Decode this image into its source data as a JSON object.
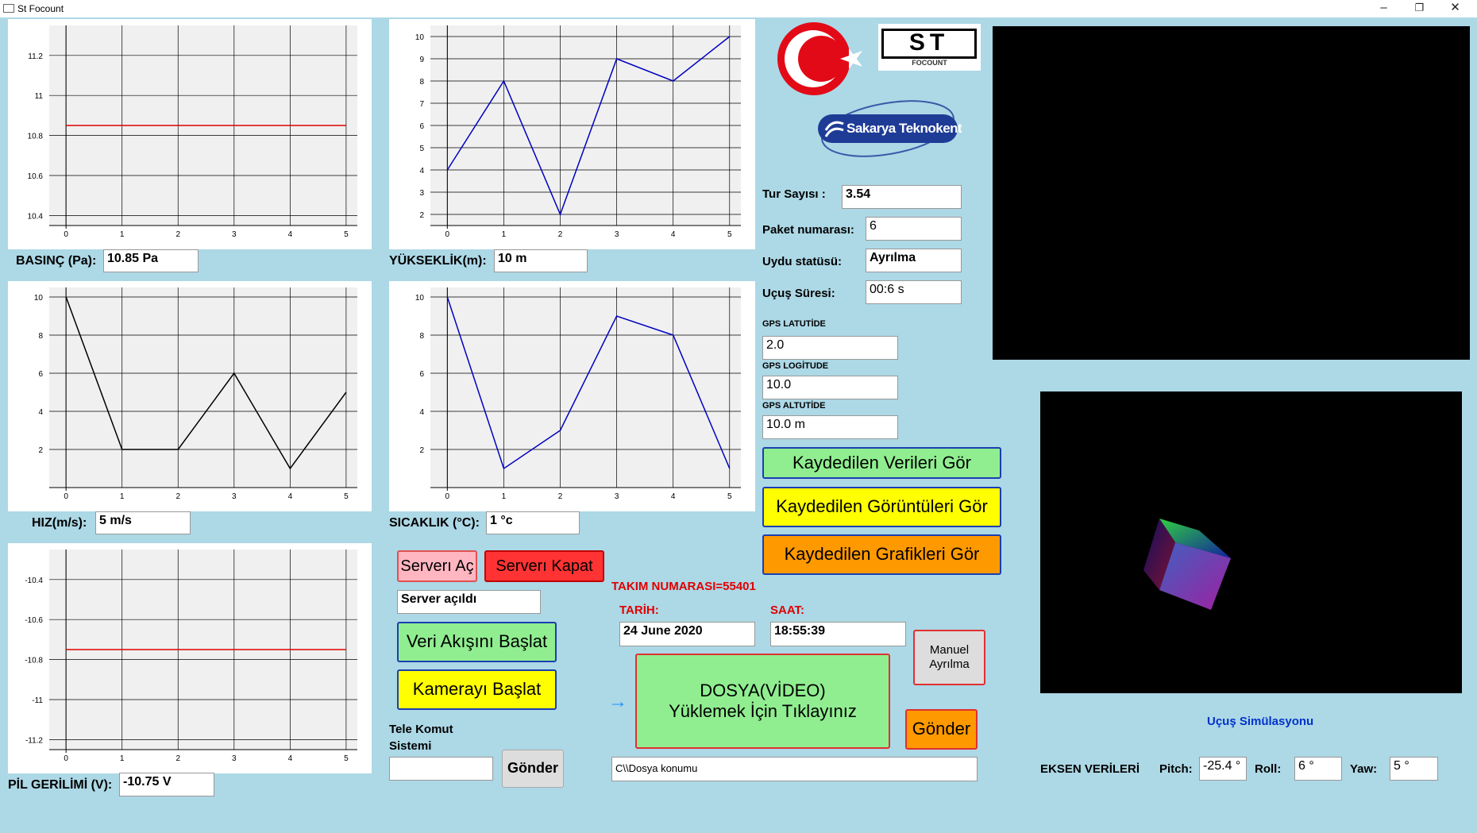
{
  "window": {
    "title": "St Focount",
    "min": "–",
    "max": "❐",
    "close": "✕"
  },
  "charts": {
    "basinc": {
      "label": "BASINÇ (Pa):",
      "value": "10.85 Pa",
      "ylim": [
        10.35,
        11.35
      ],
      "yticks": [
        "11.2",
        "11",
        "10.8",
        "10.6",
        "10.4"
      ],
      "ytickvals": [
        11.2,
        11,
        10.8,
        10.6,
        10.4
      ],
      "xticks": [
        "0",
        "1",
        "2",
        "3",
        "4",
        "5"
      ],
      "x": [
        0,
        1,
        2,
        3,
        4,
        5
      ],
      "y": [
        10.85,
        10.85,
        10.85,
        10.85,
        10.85,
        10.85
      ],
      "color": "#e00000"
    },
    "yukseklik": {
      "label": "YÜKSEKLİK(m):",
      "value": "10 m",
      "ylim": [
        1.5,
        10.5
      ],
      "yticks": [
        "10",
        "9",
        "8",
        "7",
        "6",
        "5",
        "4",
        "3",
        "2"
      ],
      "ytickvals": [
        10,
        9,
        8,
        7,
        6,
        5,
        4,
        3,
        2
      ],
      "xticks": [
        "0",
        "1",
        "2",
        "3",
        "4",
        "5"
      ],
      "x": [
        0,
        1,
        2,
        3,
        4,
        5
      ],
      "y": [
        4,
        8,
        2,
        9,
        8,
        10
      ],
      "color": "#0000c0"
    },
    "hiz": {
      "label": "HIZ(m/s):",
      "value": "5 m/s",
      "ylim": [
        0,
        10.5
      ],
      "yticks": [
        "10",
        "8",
        "6",
        "4",
        "2"
      ],
      "ytickvals": [
        10,
        8,
        6,
        4,
        2
      ],
      "xticks": [
        "0",
        "1",
        "2",
        "3",
        "4",
        "5"
      ],
      "x": [
        0,
        1,
        2,
        3,
        4,
        5
      ],
      "y": [
        10,
        2,
        2,
        6,
        1,
        5
      ],
      "color": "#000000"
    },
    "sicaklik": {
      "label": "SICAKLIK (°C):",
      "value": "1 °c",
      "ylim": [
        0,
        10.5
      ],
      "yticks": [
        "10",
        "8",
        "6",
        "4",
        "2"
      ],
      "ytickvals": [
        10,
        8,
        6,
        4,
        2
      ],
      "xticks": [
        "0",
        "1",
        "2",
        "3",
        "4",
        "5"
      ],
      "x": [
        0,
        1,
        2,
        3,
        4,
        5
      ],
      "y": [
        10,
        1,
        3,
        9,
        8,
        1
      ],
      "color": "#0000c0"
    },
    "pil": {
      "label": "PİL GERİLİMİ (V):",
      "value": "-10.75 V",
      "ylim": [
        -11.25,
        -10.25
      ],
      "yticks": [
        "-10.4",
        "-10.6",
        "-10.8",
        "-11",
        "-11.2"
      ],
      "ytickvals": [
        -10.4,
        -10.6,
        -10.8,
        -11,
        -11.2
      ],
      "xticks": [
        "0",
        "1",
        "2",
        "3",
        "4",
        "5"
      ],
      "x": [
        0,
        1,
        2,
        3,
        4,
        5
      ],
      "y": [
        -10.75,
        -10.75,
        -10.75,
        -10.75,
        -10.75,
        -10.75
      ],
      "color": "#e00000"
    }
  },
  "server": {
    "open": "Serverı Aç",
    "close": "Serverı Kapat",
    "status": "Server açıldı",
    "stream": "Veri Akışını Başlat",
    "camera": "Kamerayı Başlat"
  },
  "telekomut": {
    "label1": "Tele Komut",
    "label2": "Sistemi",
    "input": "",
    "send": "Gönder"
  },
  "team": {
    "number": "TAKIM NUMARASI=55401",
    "date_label": "TARİH:",
    "date": "24 June 2020",
    "time_label": "SAAT:",
    "time": "18:55:39"
  },
  "upload": {
    "line1": "DOSYA(VİDEO)",
    "line2": "Yüklemek İçin Tıklayınız",
    "arrow": "→",
    "path": "C\\\\Dosya konumu",
    "send": "Gönder",
    "manual1": "Manuel",
    "manual2": "Ayrılma"
  },
  "logos": {
    "teknokent": "Sakarya Teknokent",
    "focount": "ST",
    "focount_sub": "FOCOUNT"
  },
  "telemetry": {
    "tur_label": "Tur Sayısı :",
    "tur": "3.54",
    "paket_label": "Paket numarası:",
    "paket": "6",
    "statu_label": "Uydu statüsü:",
    "statu": "Ayrılma",
    "sure_label": "Uçuş Süresi:",
    "sure": "00:6 s",
    "lat_label": "GPS LATUTİDE",
    "lat": "2.0",
    "lon_label": "GPS LOGİTUDE",
    "lon": "10.0",
    "alt_label": "GPS ALTUTİDE",
    "alt": "10.0 m"
  },
  "actions": {
    "verileri": "Kaydedilen Verileri Gör",
    "goruntuleri": "Kaydedilen Görüntüleri Gör",
    "grafikleri": "Kaydedilen Grafikleri Gör"
  },
  "simulation": {
    "title": "Uçuş Simülasyonu",
    "eksen": "EKSEN VERİLERİ",
    "pitch_label": "Pitch:",
    "pitch": "-25.4 °",
    "roll_label": "Roll:",
    "roll": "6 °",
    "yaw_label": "Yaw:",
    "yaw": "5 °"
  }
}
